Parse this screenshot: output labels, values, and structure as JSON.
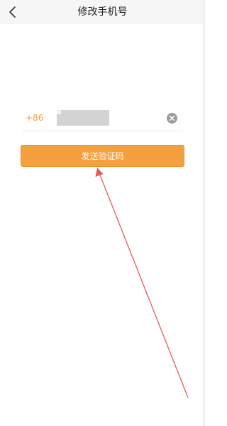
{
  "header": {
    "title": "修改手机号",
    "back_icon": "chevron-left-icon"
  },
  "phone_form": {
    "country_code": "+86",
    "phone_value": "",
    "phone_masked": true,
    "clear_icon": "clear-circle-icon"
  },
  "actions": {
    "send_code_label": "发送验证码"
  },
  "colors": {
    "accent": "#f5a03f",
    "navbar_bg": "#f6f6f6",
    "annotation_arrow": "#e85a5a"
  }
}
